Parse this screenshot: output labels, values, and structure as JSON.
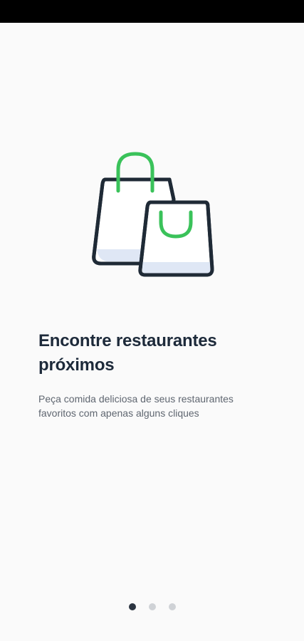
{
  "onboarding": {
    "title": "Encontre restaurantes próximos",
    "description": "Peça comida deliciosa de seus restaurantes favoritos com apenas alguns cliques",
    "illustration_icon": "shopping-bags-icon",
    "pagination": {
      "total_pages": 3,
      "current_page": 1
    }
  },
  "colors": {
    "accent": "#3ac25a",
    "outline": "#1f2a36",
    "bag_fill": "#dfe7f5",
    "title": "#1d2a3a",
    "text": "#5f6670",
    "dot_active": "#2b3440",
    "dot_inactive": "#cfd2d6"
  }
}
